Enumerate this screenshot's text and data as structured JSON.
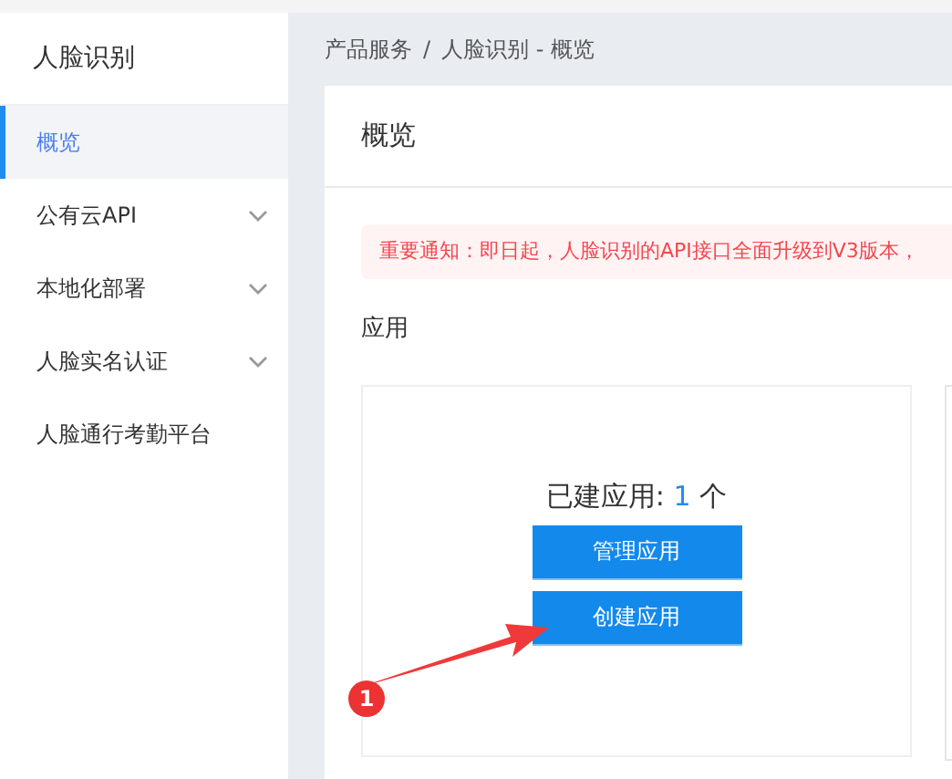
{
  "sidebar": {
    "title": "人脸识别",
    "items": [
      {
        "label": "概览",
        "selected": true,
        "expandable": false
      },
      {
        "label": "公有云API",
        "selected": false,
        "expandable": true
      },
      {
        "label": "本地化部署",
        "selected": false,
        "expandable": true
      },
      {
        "label": "人脸实名认证",
        "selected": false,
        "expandable": true
      },
      {
        "label": "人脸通行考勤平台",
        "selected": false,
        "expandable": false
      }
    ]
  },
  "breadcrumb": {
    "separator": "/",
    "items": [
      "产品服务",
      "人脸识别 - 概览"
    ]
  },
  "page": {
    "title": "概览",
    "notice": "重要通知：即日起，人脸识别的API接口全面升级到V3版本，",
    "section": "应用",
    "app_count_label": "已建应用: ",
    "app_count": "1",
    "app_count_unit": " 个",
    "buttons": [
      "管理应用",
      "创建应用"
    ]
  },
  "annotation": {
    "badge": "1"
  }
}
